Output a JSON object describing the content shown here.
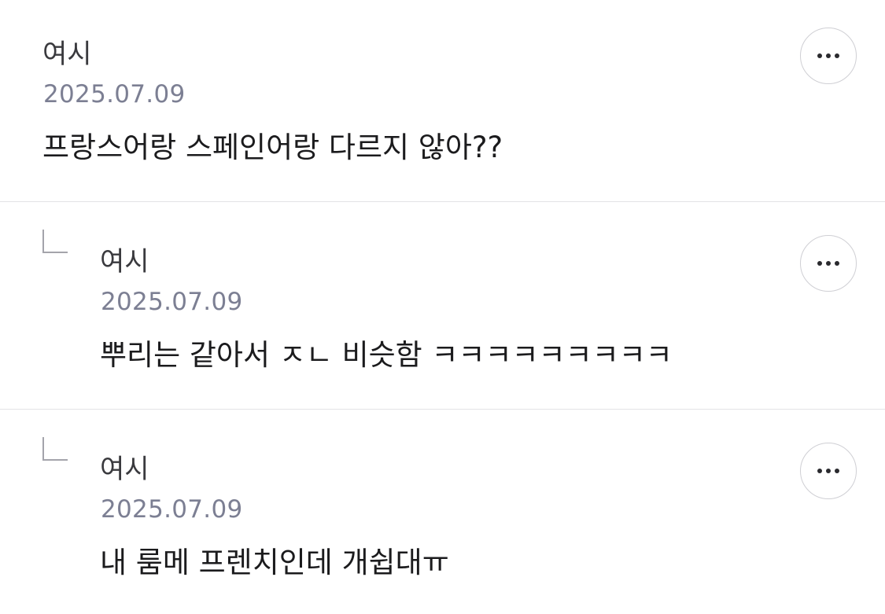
{
  "comments": [
    {
      "author": "여시",
      "date": "2025.07.09",
      "text": "프랑스어랑 스페인어랑 다르지 않아??",
      "is_reply": false,
      "more_icon": "more-horizontal-icon"
    },
    {
      "author": "여시",
      "date": "2025.07.09",
      "text": "뿌리는 같아서 ㅈㄴ 비슷함 ㅋㅋㅋㅋㅋㅋㅋㅋㅋ",
      "is_reply": true,
      "reply_icon": "reply-arrow-icon",
      "more_icon": "more-horizontal-icon"
    },
    {
      "author": "여시",
      "date": "2025.07.09",
      "text": "내 룸메 프렌치인데 개쉽대ㅠ",
      "is_reply": true,
      "reply_icon": "reply-arrow-icon",
      "more_icon": "more-horizontal-icon"
    }
  ],
  "colors": {
    "background": "#ffffff",
    "author": "#3a3a3e",
    "date": "#7c7f93",
    "text": "#1b1b1d",
    "divider": "#e3e3e6",
    "button_border": "#cfcfd4"
  }
}
